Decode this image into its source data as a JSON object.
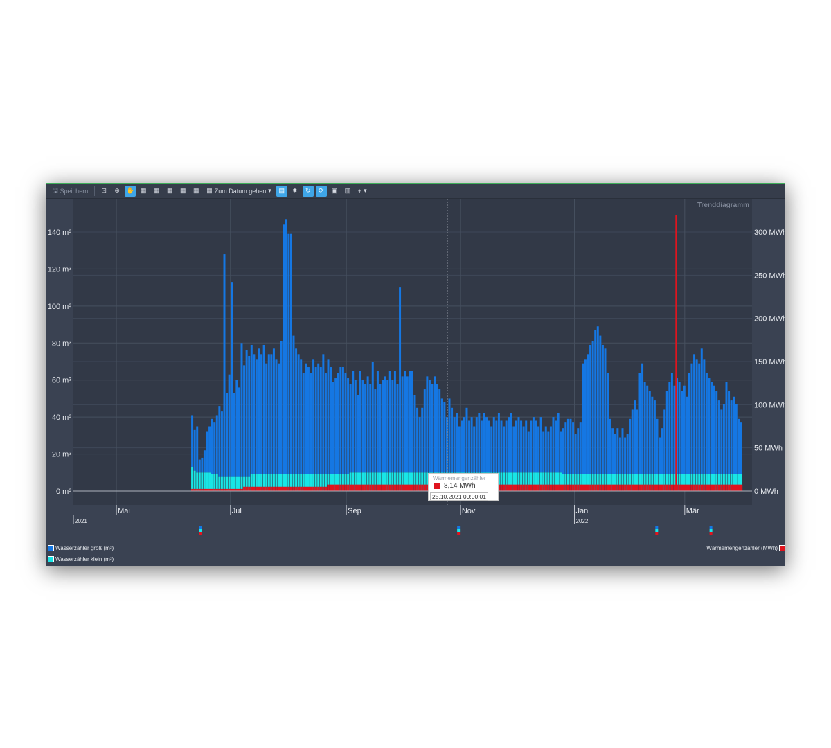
{
  "toolbar": {
    "save_label": "Speichern",
    "goto_label": "Zum Datum gehen",
    "icons": [
      "zoom-rect-icon",
      "zoom-in-icon",
      "pan-hand-icon",
      "calendar-day-icon",
      "calendar-week-icon",
      "calendar-month-icon",
      "calendar-quarter-icon",
      "calendar-year-icon",
      "calendar-goto-icon",
      "table-icon",
      "settings-icon",
      "refresh-icon",
      "auto-refresh-icon",
      "export-image-icon",
      "clipboard-icon",
      "add-icon"
    ]
  },
  "chart_title": "Trenddiagramm",
  "colors": {
    "gross": "#1577e3",
    "klein": "#18e6e6",
    "waerme": "#e0141e",
    "background": "#333a48",
    "plot": "#313847"
  },
  "chart_data": {
    "type": "bar",
    "title": "Trenddiagramm",
    "x_axis": {
      "months": [
        "Mai",
        "Jul",
        "Sep",
        "Nov",
        "Jan",
        "Mär"
      ],
      "years": [
        "2021",
        "2022"
      ],
      "range": [
        "2021-04-08",
        "2022-04-06"
      ]
    },
    "y_left": {
      "unit": "m³",
      "ticks": [
        "0 m³",
        "20 m³",
        "40 m³",
        "60 m³",
        "80 m³",
        "100 m³",
        "120 m³",
        "140 m³"
      ],
      "min": 0,
      "max": 150
    },
    "y_right": {
      "unit": "MWh",
      "ticks": [
        "0 MWh",
        "50 MWh",
        "100 MWh",
        "150 MWh",
        "200 MWh",
        "250 MWh",
        "300 MWh"
      ],
      "min": 0,
      "max": 320
    },
    "x_start": "2021-06-10",
    "series": [
      {
        "name": "Wasserzähler groß (m³)",
        "axis": "left",
        "stacked": true,
        "values_m3": [
          28,
          22,
          25,
          7,
          8,
          12,
          22,
          25,
          30,
          28,
          32,
          38,
          35,
          120,
          45,
          55,
          105,
          45,
          52,
          48,
          72,
          60,
          68,
          65,
          70,
          65,
          62,
          68,
          65,
          70,
          60,
          65,
          65,
          68,
          62,
          60,
          72,
          135,
          138,
          130,
          130,
          75,
          68,
          65,
          62,
          55,
          60,
          58,
          55,
          62,
          58,
          60,
          58,
          65,
          55,
          62,
          58,
          50,
          52,
          55,
          58,
          58,
          55,
          52,
          48,
          55,
          50,
          42,
          55,
          50,
          48,
          52,
          48,
          60,
          45,
          55,
          48,
          50,
          52,
          50,
          55,
          50,
          55,
          48,
          100,
          52,
          55,
          52,
          55,
          55,
          42,
          35,
          30,
          35,
          45,
          52,
          50,
          48,
          52,
          48,
          45,
          40,
          38,
          30,
          40,
          35,
          30,
          32,
          25,
          28,
          30,
          35,
          28,
          30,
          25,
          30,
          32,
          28,
          32,
          30,
          28,
          25,
          30,
          28,
          32,
          28,
          25,
          28,
          30,
          32,
          25,
          28,
          30,
          28,
          25,
          28,
          22,
          28,
          30,
          28,
          25,
          30,
          22,
          25,
          22,
          25,
          30,
          28,
          32,
          22,
          25,
          28,
          30,
          30,
          28,
          22,
          25,
          28,
          60,
          62,
          65,
          70,
          72,
          78,
          80,
          75,
          70,
          68,
          55,
          30,
          25,
          22,
          25,
          20,
          25,
          20,
          22,
          30,
          35,
          40,
          35,
          55,
          60,
          50,
          48,
          45,
          42,
          40,
          30,
          20,
          25,
          35,
          45,
          50,
          55,
          48,
          52,
          50,
          45,
          48,
          42,
          55,
          60,
          65,
          62,
          60,
          68,
          62,
          55,
          52,
          50,
          48,
          45,
          40,
          35,
          38,
          50,
          45,
          40,
          42,
          38,
          30,
          28
        ],
        "values_klein_m3": [
          13,
          11,
          10,
          10,
          10,
          10,
          10,
          10,
          9,
          9,
          9,
          8,
          8,
          8,
          8,
          8,
          8,
          8,
          8,
          8,
          8,
          8,
          8,
          8,
          9,
          9,
          9,
          9,
          9,
          9,
          9,
          9,
          9,
          9,
          9,
          9,
          9,
          9,
          9,
          9,
          9,
          9,
          9,
          9,
          9,
          9,
          9,
          9,
          9,
          9,
          9,
          9,
          9,
          9,
          9,
          9,
          9,
          9,
          9,
          9,
          9,
          9,
          9,
          9,
          10,
          10,
          10,
          10,
          10,
          10,
          10,
          10,
          10,
          10,
          10,
          10,
          10,
          10,
          10,
          10,
          10,
          10,
          10,
          10,
          10,
          10,
          10,
          10,
          10,
          10,
          10,
          10,
          10,
          10,
          10,
          10,
          10,
          10,
          10,
          10,
          10,
          10,
          10,
          10,
          10,
          10,
          10,
          10,
          10,
          10,
          10,
          10,
          10,
          10,
          10,
          10,
          10,
          10,
          10,
          10,
          10,
          10,
          10,
          10,
          10,
          10,
          10,
          10,
          10,
          10,
          10,
          10,
          10,
          10,
          10,
          10,
          10,
          10,
          10,
          10,
          10,
          10,
          10,
          10,
          10,
          10,
          10,
          10,
          10,
          10,
          9,
          9,
          9,
          9,
          9,
          9,
          9,
          9,
          9,
          9,
          9,
          9,
          9,
          9,
          9,
          9,
          9,
          9,
          9,
          9,
          9,
          9,
          9,
          9,
          9,
          9,
          9,
          9,
          9,
          9,
          9,
          9,
          9,
          9,
          9,
          9,
          9,
          9,
          9,
          9,
          9,
          9,
          9,
          9,
          9,
          9,
          9,
          9,
          9,
          9,
          9,
          9,
          9,
          9,
          9,
          9,
          9,
          9,
          9,
          9,
          9,
          9,
          9,
          9,
          9,
          9,
          9,
          9,
          9,
          9,
          9,
          9,
          9,
          9,
          9
        ]
      },
      {
        "name": "Wasserzähler klein (m³)",
        "axis": "left",
        "stacked": true
      },
      {
        "name": "Wärmemengenzähler (MWh)",
        "axis": "right",
        "stacked": false,
        "values_mwh_profile": [
          1,
          1,
          1,
          1,
          1,
          1,
          1,
          1,
          1,
          1,
          1,
          1,
          1,
          1,
          1,
          1,
          1,
          1,
          1,
          1,
          1,
          2,
          2,
          2,
          2,
          2,
          2,
          2,
          2,
          2,
          2,
          2,
          2,
          2,
          2,
          2,
          2,
          2,
          2,
          2,
          2,
          2,
          2,
          2,
          2,
          2,
          2,
          2,
          2,
          2,
          2,
          2,
          2,
          2,
          2,
          3,
          3,
          3,
          3,
          3,
          3,
          3,
          3,
          3,
          3,
          3,
          3,
          3,
          3,
          3,
          3,
          3,
          3,
          3,
          3,
          3,
          3,
          3,
          3,
          3,
          3,
          3,
          3,
          3,
          3,
          3,
          3,
          3,
          3,
          3,
          3,
          3,
          3,
          3,
          3,
          3,
          3,
          3,
          3,
          3,
          3,
          3,
          3,
          3,
          3,
          3,
          3,
          3,
          3,
          3,
          3,
          3,
          3,
          3,
          3,
          3,
          3,
          3,
          3,
          3,
          3,
          3,
          3,
          3,
          3,
          3,
          3,
          3,
          3,
          3,
          3,
          3,
          3,
          3,
          3,
          3,
          3,
          3,
          3,
          3,
          3,
          3,
          3,
          3,
          3,
          3,
          3,
          3,
          3,
          3,
          3,
          3,
          3,
          3,
          3,
          3,
          3,
          3,
          3,
          3,
          3,
          3,
          3,
          3,
          3,
          3,
          3,
          3,
          3,
          3,
          3,
          3,
          3,
          3,
          3,
          3,
          3,
          3,
          3,
          3,
          3,
          3,
          3,
          3,
          3,
          3,
          3,
          3,
          3,
          3,
          3,
          3,
          3,
          3,
          3,
          3,
          3,
          3,
          3,
          3,
          3,
          3,
          3,
          3,
          3,
          3,
          3,
          3,
          3,
          3,
          3,
          3,
          3,
          3,
          3,
          3,
          3,
          3,
          3,
          3,
          3,
          3,
          3,
          3,
          3,
          3
        ],
        "spike": {
          "date": "2022-02-24",
          "value_mwh": 320
        }
      }
    ],
    "tooltip": {
      "series": "Wärmemengenzähler",
      "value": "8,14 MWh",
      "date": "25.10.2021 00:00:01"
    },
    "legend_left": [
      "Wasserzähler groß (m³)",
      "Wasserzähler klein (m³)"
    ],
    "legend_right": [
      "Wärmemengenzähler (MWh)"
    ],
    "grid": true
  }
}
